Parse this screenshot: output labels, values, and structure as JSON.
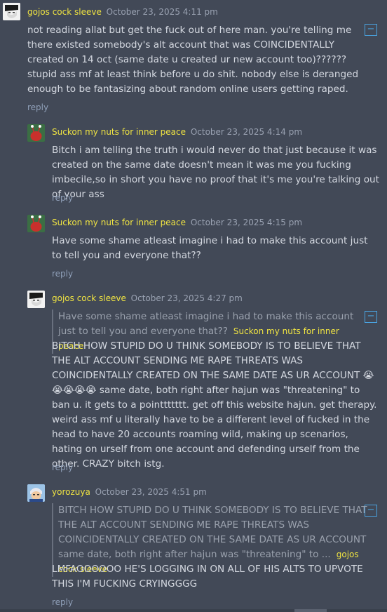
{
  "comments": [
    {
      "user": "gojos cock sleeve",
      "date": "October 23, 2025 4:11 pm",
      "avatar": "manga-face-avatar",
      "text": "not reading allat but get the fuck out of here man. you're telling me there existed somebody's alt account that was COINCIDENTALLY created on 14 oct (same date u created ur new account too)?????? stupid ass mf at least think before u do shit. nobody else is deranged enough to be fantasizing about random online users getting raped.",
      "reply": "reply",
      "toggle": "−"
    },
    {
      "user": "Suckon my nuts for inner peace",
      "date": "October 23, 2025 4:14 pm",
      "avatar": "mr-krabs-avatar",
      "text": "Bitch i am telling the truth i would never do that just because it was created on the same date doesn't mean it was me you fucking imbecile,so in short you have no proof that it's me you're talking out of your ass",
      "reply": "reply"
    },
    {
      "user": "Suckon my nuts for inner peace",
      "date": "October 23, 2025 4:15 pm",
      "avatar": "mr-krabs-avatar",
      "text": "Have some shame atleast imagine i had to make this account just to tell you and everyone that??",
      "reply": "reply"
    },
    {
      "user": "gojos cock sleeve",
      "date": "October 23, 2025 4:27 pm",
      "avatar": "manga-face-avatar",
      "quote": "Have some shame atleast imagine i had to make this account just to tell you and everyone that??",
      "quote_author": "Suckon my nuts for inner peace",
      "text": "BITCH HOW STUPID DO U THINK SOMEBODY IS TO BELIEVE THAT THE ALT ACCOUNT SENDING ME RAPE THREATS WAS COINCIDENTALLY CREATED ON THE SAME DATE AS UR ACCOUNT 😭😭😭😭😭 same date, both right after hajun was \"threatening\" to ban u. it gets to a pointtttttt. get off this website hajun. get therapy. weird ass mf u literally have to be a different level of fucked in the head to have 20 accounts roaming wild, making up scenarios, hating on urself from one account and defending urself from the other. CRAZY bitch istg.",
      "reply": "reply",
      "toggle": "−"
    },
    {
      "user": "yorozuya",
      "date": "October 23, 2025 4:51 pm",
      "avatar": "gintoki-avatar",
      "quote": "BITCH HOW STUPID DO U THINK SOMEBODY IS TO BELIEVE THAT THE ALT ACCOUNT SENDING ME RAPE THREATS WAS COINCIDENTALLY CREATED ON THE SAME DATE AS UR ACCOUNT same date, both right after hajun was \"threatening\" to ...",
      "quote_author": "gojos cock sleeve",
      "text": "LMFAOOOOOO HE'S LOGGING IN ON ALL OF HIS ALTS TO UPVOTE THIS I'M FUCKING CRYINGGGG",
      "reply": "reply",
      "toggle": "−"
    }
  ],
  "colors": {
    "background": "#424957",
    "username": "#f0e442",
    "reply": "#8f9fb8",
    "toggle": "#4aa3e0"
  }
}
